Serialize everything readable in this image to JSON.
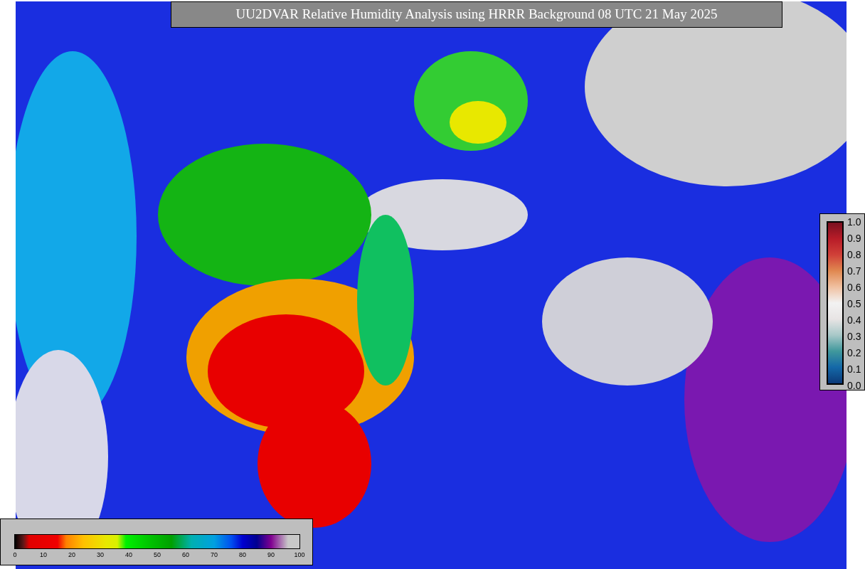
{
  "title": "UU2DVAR Relative Humidity Analysis using HRRR Background 08 UTC 21 May 2025",
  "weight_colorbar": {
    "ticks": [
      "1.0",
      "0.9",
      "0.8",
      "0.7",
      "0.6",
      "0.5",
      "0.4",
      "0.3",
      "0.2",
      "0.1",
      "0.0"
    ]
  },
  "humidity_colorbar": {
    "ticks": [
      "0",
      "10",
      "20",
      "30",
      "40",
      "50",
      "60",
      "70",
      "80",
      "90",
      "100"
    ]
  }
}
